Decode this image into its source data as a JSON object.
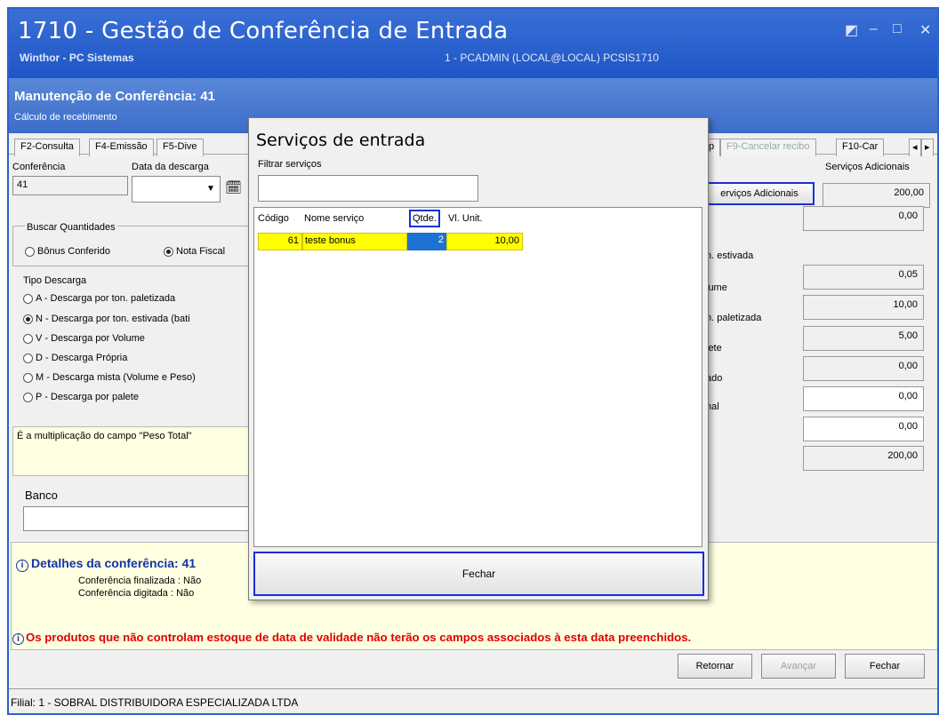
{
  "window": {
    "title": "1710 - Gestão de Conferência de Entrada",
    "app_name": "Winthor - PC Sistemas",
    "session_info": "1 - PCADMIN (LOCAL@LOCAL)   PCSIS1710"
  },
  "header": {
    "title": "Manutenção de Conferência: 41",
    "subtitle": "Cálculo de recebimento"
  },
  "tabs": [
    "F2-Consulta",
    "F4-Emissão",
    "F5-Dive",
    "p",
    "F9-Cancelar recibo",
    "F10-Car"
  ],
  "form": {
    "conferencia_label": "Conferência",
    "conferencia_value": "41",
    "data_descarga_label": "Data da descarga",
    "servicos_adicionais_label": "Serviços Adicionais",
    "servicos_adicionais_button": "erviços Adicionais",
    "servicos_adicionais_value": "200,00",
    "buscar_label": "Buscar Quantidades",
    "bonus_option": "Bônus Conferido",
    "nota_option": "Nota Fiscal",
    "tipo_label": "Tipo Descarga",
    "tipos": [
      "A - Descarga por ton. paletizada",
      "N - Descarga por ton. estivada (bati",
      "V - Descarga por Volume",
      "D - Descarga Própria",
      "M - Descarga mista (Volume e Peso)",
      "P -  Descarga por palete"
    ],
    "hint_text": "É a multiplicação do campo \"Peso Total\"",
    "banco_label": "Banco",
    "right_labels": [
      "n. estivada",
      "lume",
      "n. paletizada",
      "lete",
      "ado",
      "nal"
    ],
    "right_values": [
      "0,00",
      "0,05",
      "10,00",
      "5,00",
      "0,00",
      "0,00",
      "0,00",
      "200,00"
    ]
  },
  "details": {
    "title": "Detalhes da conferência: 41",
    "finalizada": "Conferência finalizada : Não",
    "digitada": "Conferência digitada : Não",
    "warning": "Os produtos que não controlam estoque de data de validade não terão os campos associados à esta data preenchidos."
  },
  "buttons": {
    "retornar": "Retornar",
    "avancar": "Avançar",
    "fechar": "Fechar"
  },
  "status_bar": "Filial: 1 - SOBRAL  DISTRIBUIDORA ESPECIALIZADA LTDA",
  "modal": {
    "title": "Serviços de entrada",
    "filter_label": "Filtrar serviços",
    "filter_value": "",
    "columns": [
      "Código",
      "Nome serviço",
      "Qtde.",
      "Vl. Unit."
    ],
    "rows": [
      {
        "codigo": "61",
        "nome": "teste bonus",
        "qtde": "2",
        "vl_unit": "10,00"
      }
    ],
    "close_button": "Fechar"
  },
  "colors": {
    "title_blue": "#1f56c6",
    "highlight_border": "#1a2fd8",
    "row_yellow": "#ffff00",
    "selected_cell": "#1e72d4",
    "warning_red": "#e00000",
    "details_blue": "#1533a8"
  }
}
